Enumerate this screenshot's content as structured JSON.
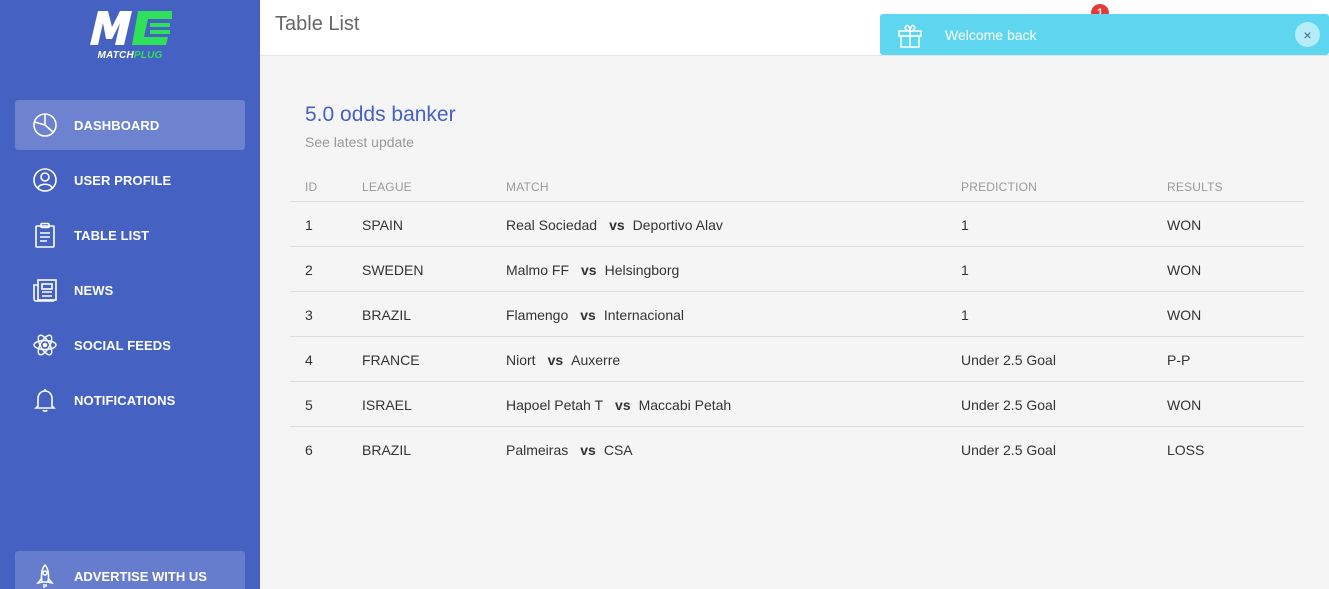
{
  "colors": {
    "sidebar": "#4561c2",
    "accent": "#4561c2",
    "toast": "#5ed6ef",
    "logo_green": "#2ee05a",
    "badge": "#e33a3a"
  },
  "logo": {
    "brand_prefix": "MATCH",
    "brand_suffix": "PLUG"
  },
  "sidebar": {
    "items": [
      {
        "label": "DASHBOARD",
        "icon": "pie-chart-icon"
      },
      {
        "label": "USER PROFILE",
        "icon": "user-icon"
      },
      {
        "label": "TABLE LIST",
        "icon": "clipboard-icon"
      },
      {
        "label": "NEWS",
        "icon": "newspaper-icon"
      },
      {
        "label": "SOCIAL FEEDS",
        "icon": "atom-icon"
      },
      {
        "label": "NOTIFICATIONS",
        "icon": "bell-icon"
      }
    ],
    "advertise": {
      "label": "ADVERTISE WITH US",
      "icon": "rocket-icon"
    }
  },
  "header": {
    "title": "Table List",
    "notification_count": "1"
  },
  "toast": {
    "message": "Welcome back",
    "close": "×",
    "icon": "gift-icon"
  },
  "card": {
    "title": "5.0 odds banker",
    "subtitle": "See latest update"
  },
  "table": {
    "columns": [
      "ID",
      "LEAGUE",
      "MATCH",
      "PREDICTION",
      "RESULTS"
    ],
    "vs": "vs",
    "rows": [
      {
        "id": "1",
        "league": "SPAIN",
        "home": "Real Sociedad",
        "away": "Deportivo Alav",
        "prediction": "1",
        "result": "WON"
      },
      {
        "id": "2",
        "league": "SWEDEN",
        "home": "Malmo FF",
        "away": "Helsingborg",
        "prediction": "1",
        "result": "WON"
      },
      {
        "id": "3",
        "league": "BRAZIL",
        "home": "Flamengo",
        "away": "Internacional",
        "prediction": "1",
        "result": "WON"
      },
      {
        "id": "4",
        "league": "FRANCE",
        "home": "Niort",
        "away": "Auxerre",
        "prediction": "Under 2.5 Goal",
        "result": "P-P"
      },
      {
        "id": "5",
        "league": "ISRAEL",
        "home": "Hapoel Petah T",
        "away": "Maccabi Petah",
        "prediction": "Under 2.5 Goal",
        "result": "WON"
      },
      {
        "id": "6",
        "league": "BRAZIL",
        "home": "Palmeiras",
        "away": "CSA",
        "prediction": "Under 2.5 Goal",
        "result": "LOSS"
      }
    ]
  }
}
